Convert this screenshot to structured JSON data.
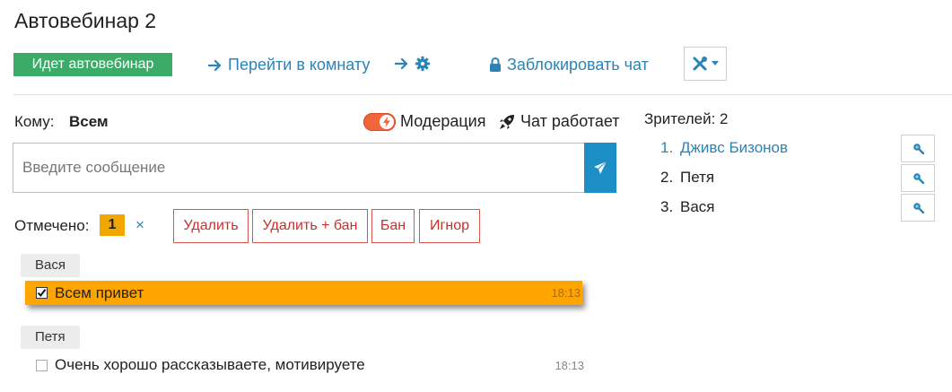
{
  "header": {
    "title": "Автовебинар 2",
    "status_label": "Идет автовебинар",
    "go_to_room_label": "Перейти в комнату",
    "lock_chat_label": "Заблокировать чат"
  },
  "chat": {
    "to_label": "Кому:",
    "to_value": "Всем",
    "moderation_label": "Модерация",
    "moderation_on": true,
    "chat_status_label": "Чат работает",
    "input_placeholder": "Введите сообщение",
    "marked_label": "Отмечено:",
    "marked_count": "1",
    "clear_symbol": "×",
    "actions": [
      "Удалить",
      "Удалить + бан",
      "Бан",
      "Игнор"
    ],
    "messages": [
      {
        "author": "Вася",
        "text": "Всем привет",
        "time": "18:13",
        "checked": true
      },
      {
        "author": "Петя",
        "text": "Очень хорошо рассказываете, мотивируете",
        "time": "18:13",
        "checked": false
      }
    ]
  },
  "viewers": {
    "label": "Зрителей: 2",
    "list": [
      {
        "num": "1.",
        "name": "Дживс Бизонов",
        "highlight": true
      },
      {
        "num": "2.",
        "name": "Петя",
        "highlight": false
      },
      {
        "num": "3.",
        "name": "Вася",
        "highlight": false
      }
    ]
  },
  "colors": {
    "accent": "#2a84b8",
    "status_green": "#3dab68",
    "selected_message": "#ffa500",
    "danger": "#d9534f",
    "send_button": "#1e8fc6",
    "toggle_on": "#f0653c"
  },
  "icons": {
    "go_to_room": "arrow-right-icon",
    "settings": "arrow-right-gear-icon",
    "lock": "lock-icon",
    "tools": "tools-icon",
    "moderation_toggle": "lightning-icon",
    "chat_status": "rocket-icon",
    "send": "paper-plane-icon",
    "viewer_search": "search-icon"
  }
}
